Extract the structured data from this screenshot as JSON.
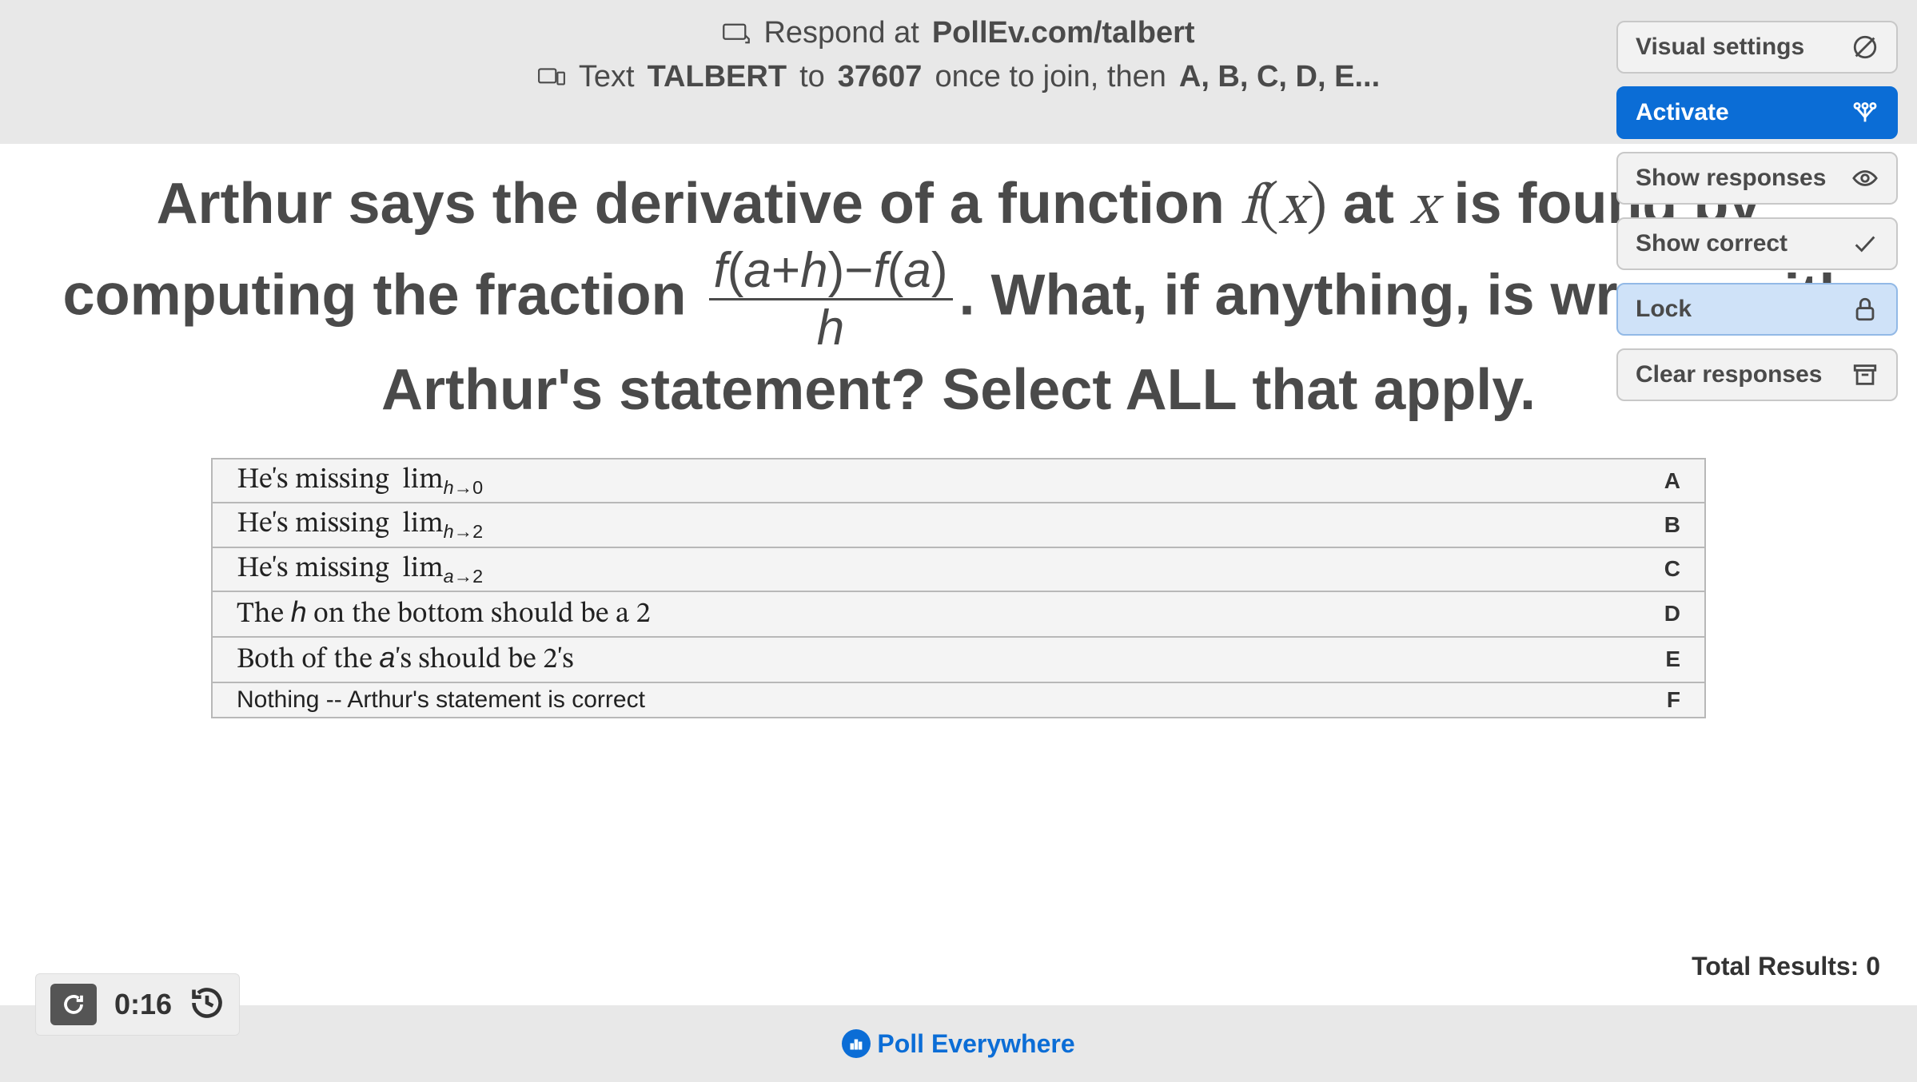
{
  "header": {
    "respond_prefix": "Respond at",
    "respond_url": "PollEv.com/talbert",
    "text_prefix": "Text",
    "text_code": "TALBERT",
    "text_mid": "to",
    "text_number": "37607",
    "text_suffix": "once to join, then",
    "text_options": "A, B, C, D, E..."
  },
  "panel": {
    "visual_settings": "Visual settings",
    "activate": "Activate",
    "show_responses": "Show responses",
    "show_correct": "Show correct",
    "lock": "Lock",
    "clear_responses": "Clear responses"
  },
  "question": {
    "part1": "Arthur says the derivative of a function ",
    "fx": "f(x)",
    "part2": " at ",
    "xeq": "x",
    "part3": " is found by computing the fraction ",
    "frac_num_plain": "f(a+h)−f(a)",
    "frac_den_plain": "h",
    "part4": ". What, if anything, is wrong with Arthur's statement? Select ALL that apply."
  },
  "options": [
    {
      "letter": "A",
      "plain": "He's missing lim_{h→0}"
    },
    {
      "letter": "B",
      "plain": "He's missing lim_{h→2}"
    },
    {
      "letter": "C",
      "plain": "He's missing lim_{a→2}"
    },
    {
      "letter": "D",
      "plain": "The h on the bottom should be a 2"
    },
    {
      "letter": "E",
      "plain": "Both of the a's should be 2's"
    },
    {
      "letter": "F",
      "plain": "Nothing -- Arthur's statement is correct"
    }
  ],
  "results": {
    "label": "Total Results: ",
    "count": "0"
  },
  "timer": {
    "value": "0:16"
  },
  "brand": {
    "name": "Poll Everywhere"
  }
}
